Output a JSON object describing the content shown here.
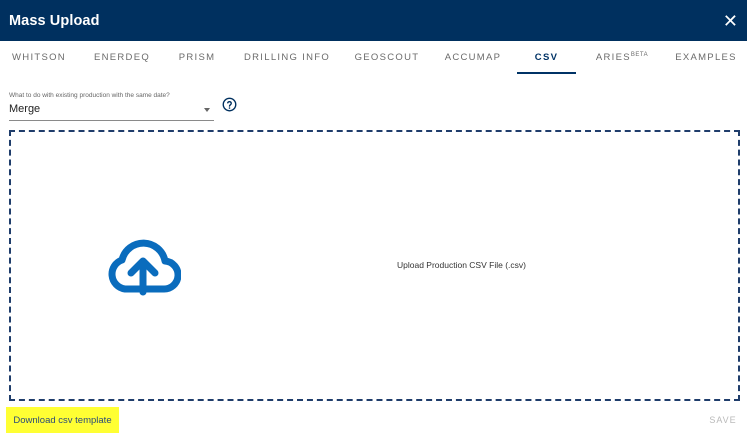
{
  "header": {
    "title": "Mass Upload",
    "close_glyph": "✕"
  },
  "tabs": [
    {
      "label": "WHITSON",
      "active": false
    },
    {
      "label": "ENERDEQ",
      "active": false
    },
    {
      "label": "PRISM",
      "active": false
    },
    {
      "label": "DRILLING INFO",
      "active": false
    },
    {
      "label": "GEOSCOUT",
      "active": false
    },
    {
      "label": "ACCUMAP",
      "active": false
    },
    {
      "label": "CSV",
      "active": true
    },
    {
      "label": "ARIES",
      "superscript": "BETA",
      "active": false
    },
    {
      "label": "EXAMPLES",
      "active": false
    }
  ],
  "production_select": {
    "label": "What to do with existing production with the same date?",
    "value": "Merge"
  },
  "dropzone": {
    "text": "Upload Production CSV File (.csv)",
    "icon": "cloud-upload-icon"
  },
  "footer": {
    "download_label": "Download csv template",
    "save_label": "SAVE"
  },
  "colors": {
    "header_bg": "#00305f",
    "accent": "#003366",
    "icon_blue": "#0a6cbd",
    "highlight": "#ffff33"
  }
}
